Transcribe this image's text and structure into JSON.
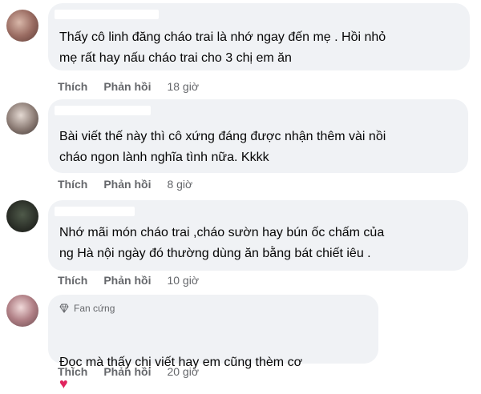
{
  "comments": [
    {
      "text": "Thấy cô linh đăng cháo trai là nhớ ngay đến mẹ . Hồi nhỏ\nmẹ rất hay nấu cháo trai cho 3 chị em ăn",
      "like": "Thích",
      "reply": "Phản hồi",
      "time": "18 giờ"
    },
    {
      "text": "Bài viết thế này thì cô xứng đáng được nhận thêm vài nồi\ncháo ngon lành nghĩa tình nữa. Kkkk",
      "like": "Thích",
      "reply": "Phản hồi",
      "time": "8 giờ"
    },
    {
      "text": "Nhớ mãi món cháo trai ,cháo sườn hay bún ốc chấm của\nng Hà nội ngày đó thường dùng ăn bằng bát chiết iêu .",
      "like": "Thích",
      "reply": "Phản hồi",
      "time": "10 giờ"
    },
    {
      "badge": "Fan cứng",
      "text": "Đọc mà thấy chị viết hay em cũng thèm cơ",
      "emoji": "♥",
      "like": "Thích",
      "reply": "Phản hồi",
      "time": "20 giờ"
    }
  ],
  "colors": {
    "bubble": "#f0f2f5",
    "action_text": "#65676b",
    "heart": "#e0245e"
  },
  "icons": [
    "diamond-icon",
    "heart-icon"
  ]
}
